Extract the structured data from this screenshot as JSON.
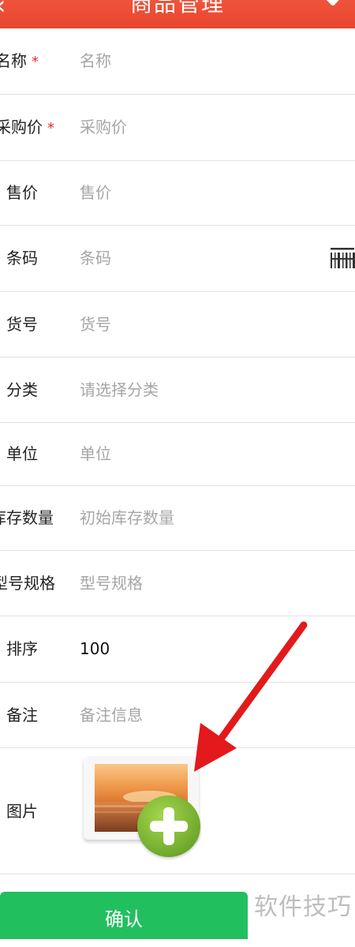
{
  "header": {
    "title": "商品管理",
    "back_icon": "chevron-left-icon",
    "confirm_icon": "check-icon",
    "background": "#e9452f"
  },
  "form": {
    "required_mark": "*",
    "name": {
      "label": "名称",
      "placeholder": "名称",
      "required": true
    },
    "purchase_price": {
      "label": "采购价",
      "placeholder": "采购价",
      "required": true
    },
    "sale_price": {
      "label": "售价",
      "placeholder": "售价"
    },
    "barcode": {
      "label": "条码",
      "placeholder": "条码",
      "scan_icon": "barcode-scan-icon"
    },
    "sku": {
      "label": "货号",
      "placeholder": "货号"
    },
    "category": {
      "label": "分类",
      "placeholder": "请选择分类"
    },
    "unit": {
      "label": "单位",
      "placeholder": "单位"
    },
    "stock": {
      "label": "库存数量",
      "placeholder": "初始库存数量"
    },
    "model": {
      "label": "型号规格",
      "placeholder": "型号规格"
    },
    "sort": {
      "label": "排序",
      "value": "100"
    },
    "remark": {
      "label": "备注",
      "placeholder": "备注信息"
    },
    "image": {
      "label": "图片",
      "add_icon": "add-image-icon"
    }
  },
  "confirm_button": {
    "label": "确认",
    "color": "#22bf5f"
  },
  "watermark": "软件技巧",
  "annotation": {
    "icon": "red-arrow-icon",
    "color": "#e3191b"
  }
}
